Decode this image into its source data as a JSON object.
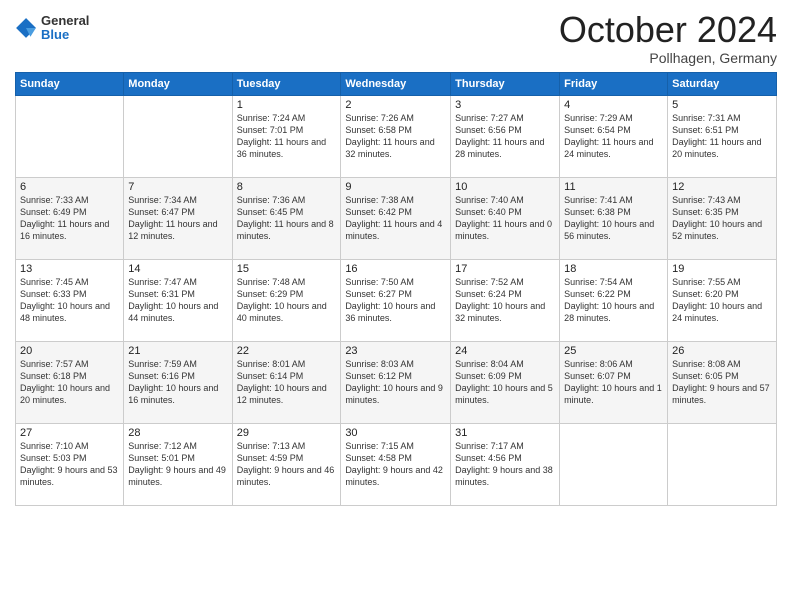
{
  "header": {
    "logo": {
      "general": "General",
      "blue": "Blue"
    },
    "month": "October 2024",
    "location": "Pollhagen, Germany"
  },
  "days": [
    "Sunday",
    "Monday",
    "Tuesday",
    "Wednesday",
    "Thursday",
    "Friday",
    "Saturday"
  ],
  "weeks": [
    [
      {
        "day": "",
        "info": ""
      },
      {
        "day": "",
        "info": ""
      },
      {
        "day": "1",
        "info": "Sunrise: 7:24 AM\nSunset: 7:01 PM\nDaylight: 11 hours and 36 minutes."
      },
      {
        "day": "2",
        "info": "Sunrise: 7:26 AM\nSunset: 6:58 PM\nDaylight: 11 hours and 32 minutes."
      },
      {
        "day": "3",
        "info": "Sunrise: 7:27 AM\nSunset: 6:56 PM\nDaylight: 11 hours and 28 minutes."
      },
      {
        "day": "4",
        "info": "Sunrise: 7:29 AM\nSunset: 6:54 PM\nDaylight: 11 hours and 24 minutes."
      },
      {
        "day": "5",
        "info": "Sunrise: 7:31 AM\nSunset: 6:51 PM\nDaylight: 11 hours and 20 minutes."
      }
    ],
    [
      {
        "day": "6",
        "info": "Sunrise: 7:33 AM\nSunset: 6:49 PM\nDaylight: 11 hours and 16 minutes."
      },
      {
        "day": "7",
        "info": "Sunrise: 7:34 AM\nSunset: 6:47 PM\nDaylight: 11 hours and 12 minutes."
      },
      {
        "day": "8",
        "info": "Sunrise: 7:36 AM\nSunset: 6:45 PM\nDaylight: 11 hours and 8 minutes."
      },
      {
        "day": "9",
        "info": "Sunrise: 7:38 AM\nSunset: 6:42 PM\nDaylight: 11 hours and 4 minutes."
      },
      {
        "day": "10",
        "info": "Sunrise: 7:40 AM\nSunset: 6:40 PM\nDaylight: 11 hours and 0 minutes."
      },
      {
        "day": "11",
        "info": "Sunrise: 7:41 AM\nSunset: 6:38 PM\nDaylight: 10 hours and 56 minutes."
      },
      {
        "day": "12",
        "info": "Sunrise: 7:43 AM\nSunset: 6:35 PM\nDaylight: 10 hours and 52 minutes."
      }
    ],
    [
      {
        "day": "13",
        "info": "Sunrise: 7:45 AM\nSunset: 6:33 PM\nDaylight: 10 hours and 48 minutes."
      },
      {
        "day": "14",
        "info": "Sunrise: 7:47 AM\nSunset: 6:31 PM\nDaylight: 10 hours and 44 minutes."
      },
      {
        "day": "15",
        "info": "Sunrise: 7:48 AM\nSunset: 6:29 PM\nDaylight: 10 hours and 40 minutes."
      },
      {
        "day": "16",
        "info": "Sunrise: 7:50 AM\nSunset: 6:27 PM\nDaylight: 10 hours and 36 minutes."
      },
      {
        "day": "17",
        "info": "Sunrise: 7:52 AM\nSunset: 6:24 PM\nDaylight: 10 hours and 32 minutes."
      },
      {
        "day": "18",
        "info": "Sunrise: 7:54 AM\nSunset: 6:22 PM\nDaylight: 10 hours and 28 minutes."
      },
      {
        "day": "19",
        "info": "Sunrise: 7:55 AM\nSunset: 6:20 PM\nDaylight: 10 hours and 24 minutes."
      }
    ],
    [
      {
        "day": "20",
        "info": "Sunrise: 7:57 AM\nSunset: 6:18 PM\nDaylight: 10 hours and 20 minutes."
      },
      {
        "day": "21",
        "info": "Sunrise: 7:59 AM\nSunset: 6:16 PM\nDaylight: 10 hours and 16 minutes."
      },
      {
        "day": "22",
        "info": "Sunrise: 8:01 AM\nSunset: 6:14 PM\nDaylight: 10 hours and 12 minutes."
      },
      {
        "day": "23",
        "info": "Sunrise: 8:03 AM\nSunset: 6:12 PM\nDaylight: 10 hours and 9 minutes."
      },
      {
        "day": "24",
        "info": "Sunrise: 8:04 AM\nSunset: 6:09 PM\nDaylight: 10 hours and 5 minutes."
      },
      {
        "day": "25",
        "info": "Sunrise: 8:06 AM\nSunset: 6:07 PM\nDaylight: 10 hours and 1 minute."
      },
      {
        "day": "26",
        "info": "Sunrise: 8:08 AM\nSunset: 6:05 PM\nDaylight: 9 hours and 57 minutes."
      }
    ],
    [
      {
        "day": "27",
        "info": "Sunrise: 7:10 AM\nSunset: 5:03 PM\nDaylight: 9 hours and 53 minutes."
      },
      {
        "day": "28",
        "info": "Sunrise: 7:12 AM\nSunset: 5:01 PM\nDaylight: 9 hours and 49 minutes."
      },
      {
        "day": "29",
        "info": "Sunrise: 7:13 AM\nSunset: 4:59 PM\nDaylight: 9 hours and 46 minutes."
      },
      {
        "day": "30",
        "info": "Sunrise: 7:15 AM\nSunset: 4:58 PM\nDaylight: 9 hours and 42 minutes."
      },
      {
        "day": "31",
        "info": "Sunrise: 7:17 AM\nSunset: 4:56 PM\nDaylight: 9 hours and 38 minutes."
      },
      {
        "day": "",
        "info": ""
      },
      {
        "day": "",
        "info": ""
      }
    ]
  ]
}
